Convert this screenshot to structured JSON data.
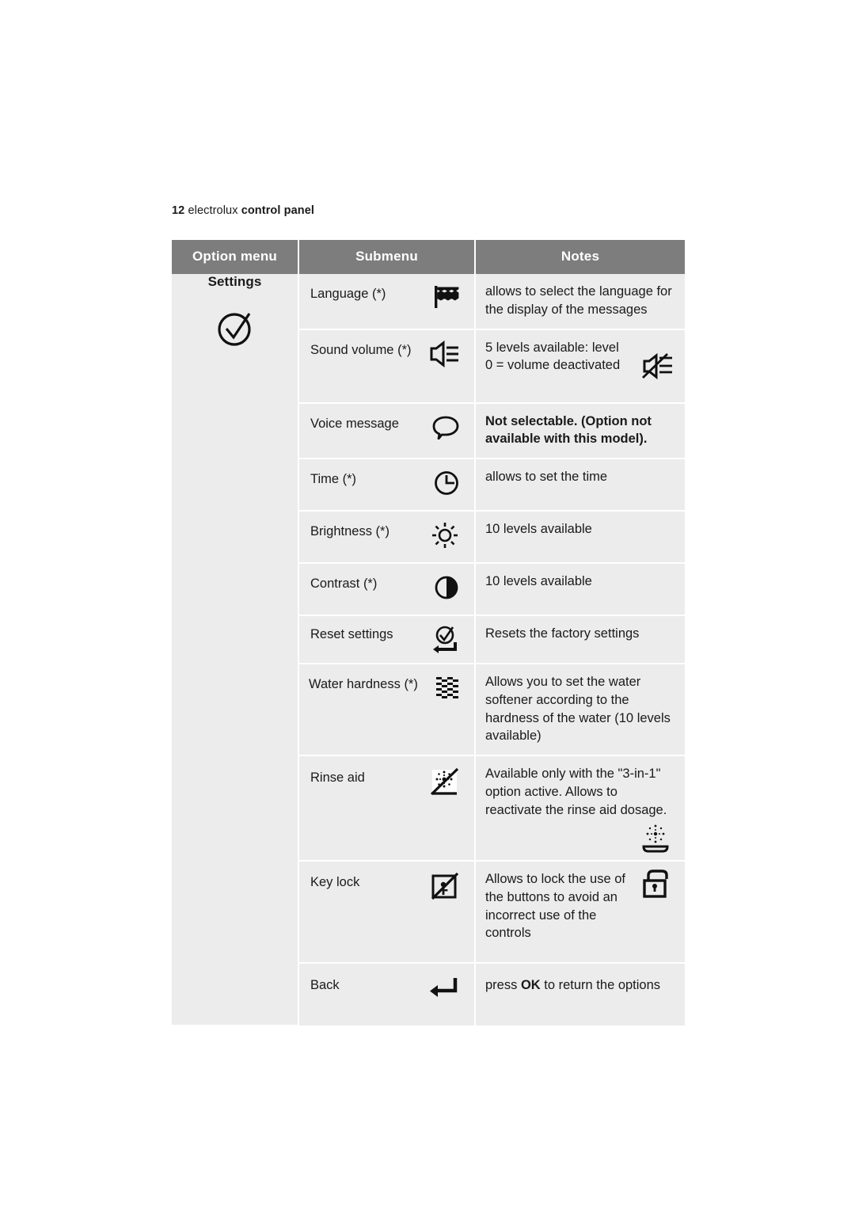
{
  "page_header": {
    "number": "12",
    "brand": "electrolux",
    "section": "control panel"
  },
  "table": {
    "headers": {
      "col1": "Option menu",
      "col2": "Submenu",
      "col3": "Notes"
    },
    "option_menu": {
      "title": "Settings",
      "icon": "check-circle-icon"
    },
    "rows": [
      {
        "submenu": "Language (*)",
        "submenu_icon": "flag-icon",
        "notes": "allows to select the language for the display of the messages",
        "notes_bold": false,
        "notes_icon": ""
      },
      {
        "submenu": "Sound volume (*)",
        "submenu_icon": "speaker-icon",
        "notes": "5 levels available: level 0 = volume deactivated",
        "notes_bold": false,
        "notes_icon": "speaker-muted-icon"
      },
      {
        "submenu": "Voice message",
        "submenu_icon": "speech-bubble-icon",
        "notes": "Not selectable. (Option not available with this model).",
        "notes_bold": true,
        "notes_icon": ""
      },
      {
        "submenu": "Time (*)",
        "submenu_icon": "clock-icon",
        "notes": "allows to set the time",
        "notes_bold": false,
        "notes_icon": ""
      },
      {
        "submenu": "Brightness (*)",
        "submenu_icon": "sun-icon",
        "notes": "10 levels available",
        "notes_bold": false,
        "notes_icon": ""
      },
      {
        "submenu": "Contrast (*)",
        "submenu_icon": "contrast-icon",
        "notes": "10 levels available",
        "notes_bold": false,
        "notes_icon": ""
      },
      {
        "submenu": "Reset settings",
        "submenu_icon": "reset-check-return-icon",
        "notes": "Resets the factory settings",
        "notes_bold": false,
        "notes_icon": ""
      },
      {
        "submenu": "Water hardness (*)",
        "submenu_icon": "water-waves-icon",
        "notes": "Allows you to set the water softener according to the hardness of the water (10 levels available)",
        "notes_bold": false,
        "notes_icon": ""
      },
      {
        "submenu": "Rinse aid",
        "submenu_icon": "rinse-aid-disabled-icon",
        "notes": "Available only with the \"3-in-1\" option active. Allows to reactivate the rinse aid dosage.",
        "notes_bold": false,
        "notes_icon": "rinse-aid-icon"
      },
      {
        "submenu": "Key lock",
        "submenu_icon": "key-lock-disabled-icon",
        "notes": "Allows to lock the use of the buttons to avoid an incorrect use of the controls",
        "notes_bold": false,
        "notes_icon": "padlock-open-icon"
      },
      {
        "submenu": "Back",
        "submenu_icon": "return-arrow-icon",
        "notes_prefix": "press ",
        "notes_key": "OK",
        "notes_suffix": " to return the options",
        "notes_bold": false,
        "notes_icon": ""
      }
    ]
  },
  "colors": {
    "header_bg": "#7d7d7d",
    "cell_bg": "#ececec",
    "text": "#1a1a1a",
    "header_text": "#ffffff"
  }
}
